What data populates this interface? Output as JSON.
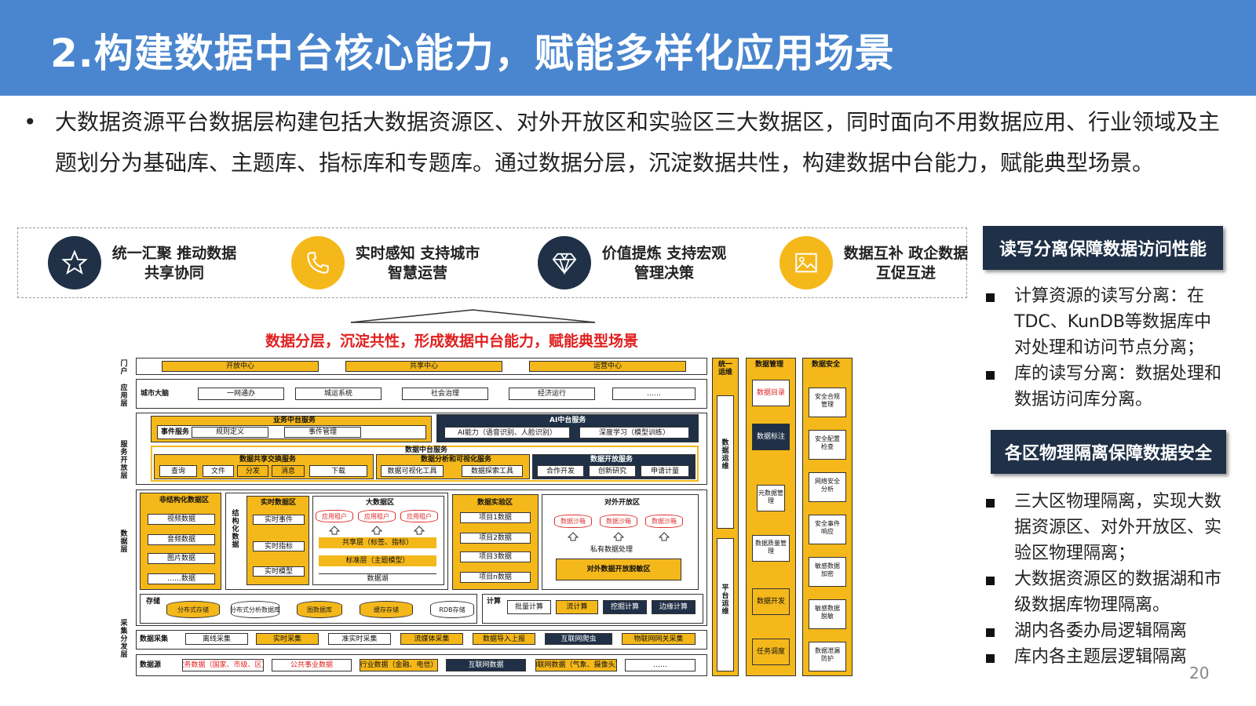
{
  "title": "2.构建数据中台核心能力，赋能多样化应用场景",
  "intro": {
    "bullet": "•",
    "text": "大数据资源平台数据层构建包括大数据资源区、对外开放区和实验区三大数据区，同时面向不用数据应用、行业领域及主题划分为基础库、主题库、指标库和专题库。通过数据分层，沉淀数据共性，构建数据中台能力，赋能典型场景。"
  },
  "features": [
    {
      "icon": "star-icon",
      "text": "统一汇聚 推动数据共享协同",
      "color": "#1f3047"
    },
    {
      "icon": "phone-icon",
      "text": "实时感知 支持城市智慧运营",
      "color": "#f5b81b"
    },
    {
      "icon": "diamond-icon",
      "text": "价值提炼 支持宏观管理决策",
      "color": "#1f3047"
    },
    {
      "icon": "image-icon",
      "text": "数据互补 政企数据互促互进",
      "color": "#f5b81b"
    }
  ],
  "diagram": {
    "subtitle": "数据分层，沉淀共性，形成数据中台能力，赋能典型场景",
    "layers": {
      "portal": "门户",
      "app": "应用层",
      "service": "服务开放层",
      "data": "数据层",
      "collect": "采集分发层"
    },
    "portal": [
      "开放中心",
      "共享中心",
      "运营中心"
    ],
    "app": {
      "label": "城市大脑",
      "items": [
        "一网通办",
        "城运系统",
        "社会治理",
        "经济运行",
        "……"
      ]
    },
    "biz": {
      "title": "业务中台服务",
      "label": "事件服务",
      "items": [
        "规则定义",
        "事件管理"
      ]
    },
    "ai": {
      "title": "AI中台服务",
      "items": [
        "AI能力（语音识别、人脸识别）",
        "深度学习（模型训练）"
      ]
    },
    "dm": {
      "title": "数据中台服务",
      "share": {
        "title": "数据共享交换服务",
        "items": [
          "查询",
          "文件",
          "分发",
          "消息",
          "下载"
        ]
      },
      "analysis": {
        "title": "数据分析和可视化服务",
        "items": [
          "数据可视化工具",
          "数据探索工具"
        ]
      },
      "open": {
        "title": "数据开放服务",
        "items": [
          "合作开发",
          "创新研究",
          "申请计量"
        ]
      }
    },
    "unstructured": {
      "title": "非结构化数据区",
      "items": [
        "视频数据",
        "音频数据",
        "图片数据",
        "……数据"
      ]
    },
    "structured": "结构化数据",
    "realtime": {
      "title": "实时数据区",
      "items": [
        "实时事件",
        "实时指标",
        "实时模型"
      ]
    },
    "bigdata": {
      "title": "大数据区",
      "tenants": [
        "应用租户",
        "应用租户",
        "应用租户"
      ],
      "share": "共享层（标签、指标）",
      "std": "标准层（主题模型）",
      "lake": "数据湖"
    },
    "exp": {
      "title": "数据实验区",
      "items": [
        "项目1数据",
        "项目2数据",
        "项目3数据",
        "项目n数据"
      ]
    },
    "openzone": {
      "title": "对外开放区",
      "sandboxes": [
        "数据沙箱",
        "数据沙箱",
        "数据沙箱"
      ],
      "private": "私有数据处理",
      "release": "对外数据开放脱敏区"
    },
    "storage": {
      "label": "存储",
      "items": [
        "分布式存储",
        "分布式分析数据库",
        "图数据库",
        "缓存存储",
        "RDB存储"
      ]
    },
    "compute": {
      "label": "计算",
      "items": [
        "批量计算",
        "流计算",
        "挖掘计算",
        "边缘计算"
      ]
    },
    "collect": {
      "label": "数据采集",
      "items": [
        "离线采集",
        "实时采集",
        "准实时采集",
        "流媒体采集",
        "数据导入上报",
        "互联网爬虫",
        "物联网网关采集"
      ]
    },
    "source": {
      "label": "数据源",
      "items": [
        "政务数据（国家、市级、区）",
        "公共事业数据",
        "行业数据（金融、电信）",
        "互联网数据",
        "物联网数据（气象、摄像头）",
        "……"
      ]
    },
    "ops": {
      "title": "统一运维",
      "data_ops": "数据运维",
      "platform_ops": "平台运维"
    },
    "mgmt": {
      "title": "数据管理",
      "items": [
        "数据目录",
        "数据标注",
        "元数据管理",
        "数据质量管理",
        "数据开发",
        "任务调度"
      ]
    },
    "sec": {
      "title": "数据安全",
      "items": [
        "安全合规管理",
        "安全配置检查",
        "网络安全分析",
        "安全事件响应",
        "敏感数据加密",
        "敏感数据脱敏",
        "数据泄漏防护"
      ]
    }
  },
  "side": {
    "h1": "读写分离保障数据访问性能",
    "list1": [
      "计算资源的读写分离：在TDC、KunDB等数据库中对处理和访问节点分离；",
      "库的读写分离：数据处理和数据访问库分离。"
    ],
    "h2": "各区物理隔离保障数据安全",
    "list2": [
      "三大区物理隔离，实现大数据资源区、对外开放区、实验区物理隔离；",
      "大数据资源区的数据湖和市级数据库物理隔离。",
      "湖内各委办局逻辑隔离",
      "库内各主题层逻辑隔离"
    ]
  },
  "page_number": "20",
  "colors": {
    "header": "#4a86cf",
    "navy": "#1f3047",
    "yellow": "#f5b81b",
    "red": "#e02020"
  }
}
